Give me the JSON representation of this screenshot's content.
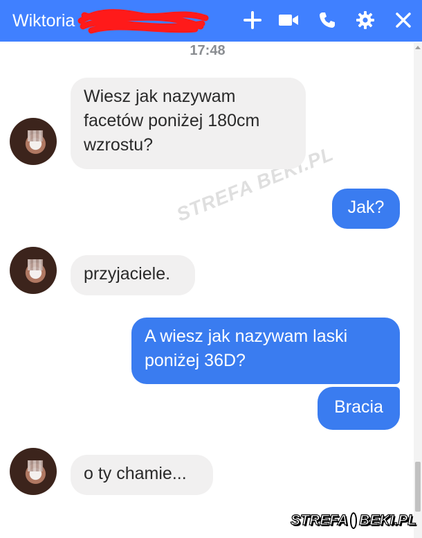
{
  "header": {
    "title": "Wiktoria",
    "background": "#4080ff",
    "icons": [
      "plus-icon",
      "video-camera-icon",
      "phone-icon",
      "gear-icon",
      "close-icon"
    ]
  },
  "conversation": {
    "timestamp": "17:48",
    "messages": [
      {
        "from": "them",
        "text": "Wiesz jak nazywam facetów poniżej 180cm wzrostu?"
      },
      {
        "from": "me",
        "text": "Jak?"
      },
      {
        "from": "them",
        "text": "przyjaciele."
      },
      {
        "from": "me",
        "text": "A wiesz jak nazywam laski poniżej 36D?"
      },
      {
        "from": "me",
        "text": "Bracia"
      },
      {
        "from": "them",
        "text": "o ty chamie..."
      }
    ],
    "incoming_color": "#f1f0f0",
    "outgoing_color": "#3a7cf0"
  },
  "watermarks": {
    "center": "STREFA BEKI.PL",
    "corner_left": "STREFA",
    "corner_right": "BEKI.PL"
  }
}
